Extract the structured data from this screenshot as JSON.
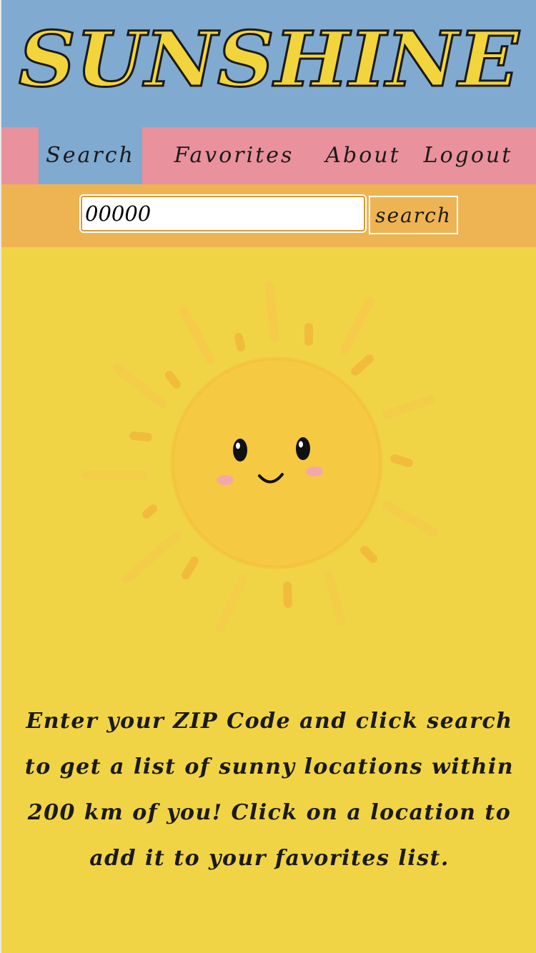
{
  "app": {
    "title": "SUNSHINE"
  },
  "nav": {
    "items": [
      {
        "label": "Search",
        "active": true
      },
      {
        "label": "Favorites",
        "active": false
      },
      {
        "label": "About",
        "active": false
      },
      {
        "label": "Logout",
        "active": false
      }
    ]
  },
  "search": {
    "value": "00000",
    "button_label": "search"
  },
  "main": {
    "illustration": "smiling-sun-icon",
    "description": "Enter your ZIP Code and click search to get a list of sunny locations within 200 km of you! Click on a location to add it to your favorites list."
  },
  "colors": {
    "header_bg": "#80aad0",
    "nav_bg": "#e9919c",
    "search_bar_bg": "#eeb453",
    "page_bg": "#f1d446",
    "logo_fill": "#f2d43c"
  }
}
